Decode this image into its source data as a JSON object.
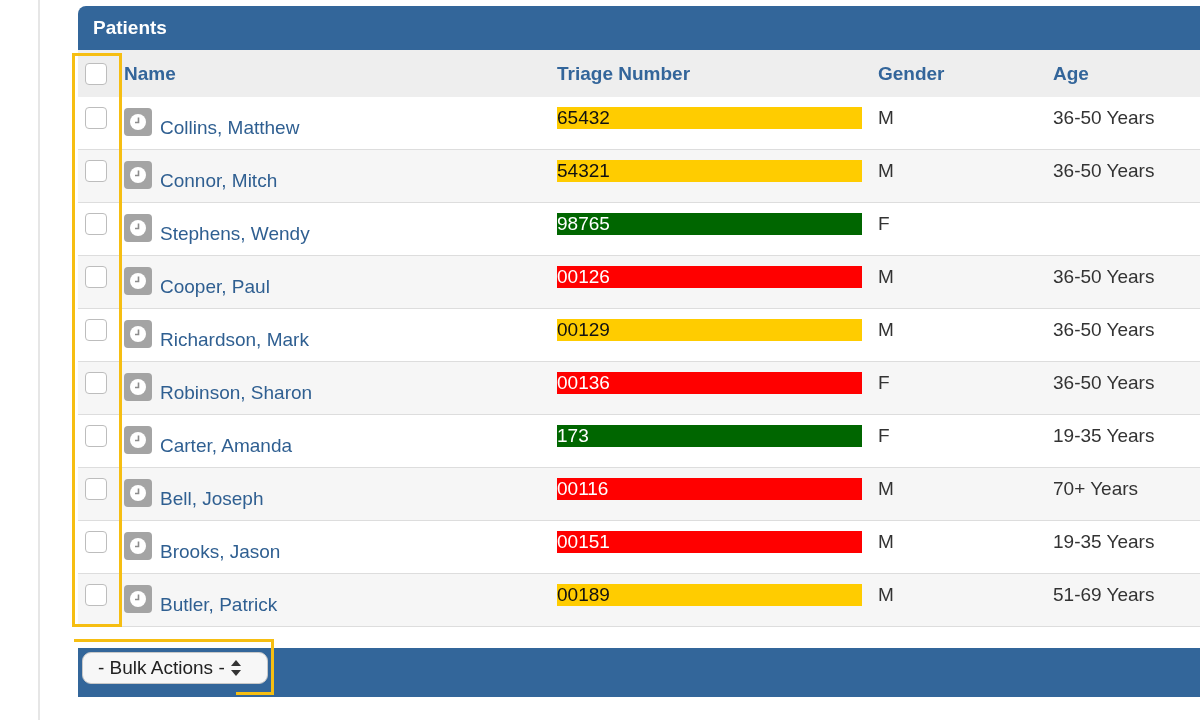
{
  "panel": {
    "title": "Patients"
  },
  "table": {
    "checkbox_column_highlighted": true,
    "select_all": {
      "checked": false
    },
    "columns": [
      {
        "label": "Name"
      },
      {
        "label": "Triage Number"
      },
      {
        "label": "Gender"
      },
      {
        "label": "Age"
      }
    ],
    "rows": [
      {
        "checked": false,
        "name": "Collins, Matthew",
        "triage": {
          "number": "65432",
          "color": "#ffcc00"
        },
        "gender": "M",
        "age": "36-50 Years"
      },
      {
        "checked": false,
        "name": "Connor, Mitch",
        "triage": {
          "number": "54321",
          "color": "#ffcc00"
        },
        "gender": "M",
        "age": "36-50 Years"
      },
      {
        "checked": false,
        "name": "Stephens, Wendy",
        "triage": {
          "number": "98765",
          "color": "#006600"
        },
        "gender": "F"
      },
      {
        "checked": false,
        "name": "Cooper, Paul",
        "triage": {
          "number": "00126",
          "color": "#ff0000"
        },
        "gender": "M",
        "age": "36-50 Years"
      },
      {
        "checked": false,
        "name": "Richardson, Mark",
        "triage": {
          "number": "00129",
          "color": "#ffcc00"
        },
        "gender": "M",
        "age": "36-50 Years"
      },
      {
        "checked": false,
        "name": "Robinson, Sharon",
        "triage": {
          "number": "00136",
          "color": "#ff0000"
        },
        "gender": "F",
        "age": "36-50 Years"
      },
      {
        "checked": false,
        "name": "Carter, Amanda",
        "triage": {
          "number": "173",
          "color": "#006600"
        },
        "gender": "F",
        "age": "19-35 Years"
      },
      {
        "checked": false,
        "name": "Bell, Joseph",
        "triage": {
          "number": "00116",
          "color": "#ff0000"
        },
        "gender": "M",
        "age": "70+ Years"
      },
      {
        "checked": false,
        "name": "Brooks, Jason",
        "triage": {
          "number": "00151",
          "color": "#ff0000"
        },
        "gender": "M",
        "age": "19-35 Years"
      },
      {
        "checked": false,
        "name": "Butler, Patrick",
        "triage": {
          "number": "00189",
          "color": "#ffcc00"
        },
        "gender": "M",
        "age": "51-69 Years"
      }
    ]
  },
  "bulk_actions": {
    "value": "- Bulk Actions -",
    "highlighted": true
  }
}
